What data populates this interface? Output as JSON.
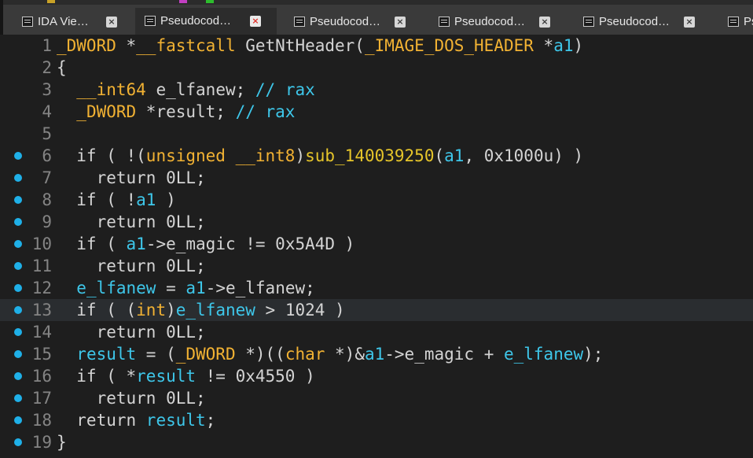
{
  "tabs": [
    {
      "label": "IDA Vie…",
      "active": false
    },
    {
      "label": "Pseudocod…",
      "active": true
    },
    {
      "label": "Pseudocod…",
      "active": false
    },
    {
      "label": "Pseudocod…",
      "active": false
    },
    {
      "label": "Pseudocod…",
      "active": false
    },
    {
      "label": "Ps",
      "active": false
    }
  ],
  "close_glyph": "×",
  "colors": {
    "breakpoint": "#1fb0e8",
    "keyword": "#f2b233",
    "variable": "#3ec7ea"
  },
  "code": {
    "lines": [
      {
        "num": "1",
        "bp": false,
        "tokens": [
          [
            "ty",
            "_DWORD"
          ],
          [
            "pl",
            " *"
          ],
          [
            "kw",
            "__fastcall"
          ],
          [
            "pl",
            " GetNtHeader("
          ],
          [
            "ty",
            "_IMAGE_DOS_HEADER"
          ],
          [
            "pl",
            " *"
          ],
          [
            "va",
            "a1"
          ],
          [
            "pl",
            ")"
          ]
        ]
      },
      {
        "num": "2",
        "bp": false,
        "tokens": [
          [
            "pl",
            "{"
          ]
        ]
      },
      {
        "num": "3",
        "bp": false,
        "tokens": [
          [
            "pl",
            "  "
          ],
          [
            "ty",
            "__int64"
          ],
          [
            "pl",
            " e_lfanew; "
          ],
          [
            "cm",
            "// rax"
          ]
        ]
      },
      {
        "num": "4",
        "bp": false,
        "tokens": [
          [
            "pl",
            "  "
          ],
          [
            "ty",
            "_DWORD"
          ],
          [
            "pl",
            " *result; "
          ],
          [
            "cm",
            "// rax"
          ]
        ]
      },
      {
        "num": "5",
        "bp": false,
        "tokens": []
      },
      {
        "num": "6",
        "bp": true,
        "tokens": [
          [
            "pl",
            "  if ( !("
          ],
          [
            "kw",
            "unsigned __int8"
          ],
          [
            "pl",
            ")"
          ],
          [
            "fn",
            "sub_140039250"
          ],
          [
            "pl",
            "("
          ],
          [
            "va",
            "a1"
          ],
          [
            "pl",
            ", 0x1000u) )"
          ]
        ]
      },
      {
        "num": "7",
        "bp": true,
        "tokens": [
          [
            "pl",
            "    return 0LL;"
          ]
        ]
      },
      {
        "num": "8",
        "bp": true,
        "tokens": [
          [
            "pl",
            "  if ( !"
          ],
          [
            "va",
            "a1"
          ],
          [
            "pl",
            " )"
          ]
        ]
      },
      {
        "num": "9",
        "bp": true,
        "tokens": [
          [
            "pl",
            "    return 0LL;"
          ]
        ]
      },
      {
        "num": "10",
        "bp": true,
        "tokens": [
          [
            "pl",
            "  if ( "
          ],
          [
            "va",
            "a1"
          ],
          [
            "pl",
            "->e_magic != 0x5A4D )"
          ]
        ]
      },
      {
        "num": "11",
        "bp": true,
        "tokens": [
          [
            "pl",
            "    return 0LL;"
          ]
        ]
      },
      {
        "num": "12",
        "bp": true,
        "tokens": [
          [
            "pl",
            "  "
          ],
          [
            "va",
            "e_lfanew"
          ],
          [
            "pl",
            " = "
          ],
          [
            "va",
            "a1"
          ],
          [
            "pl",
            "->e_lfanew;"
          ]
        ]
      },
      {
        "num": "13",
        "bp": true,
        "cur": true,
        "tokens": [
          [
            "pl",
            "  if ( ("
          ],
          [
            "kw",
            "int"
          ],
          [
            "pl",
            ")"
          ],
          [
            "va",
            "e_lfanew"
          ],
          [
            "pl",
            " > 1024 )"
          ]
        ]
      },
      {
        "num": "14",
        "bp": true,
        "tokens": [
          [
            "pl",
            "    return 0LL;"
          ]
        ]
      },
      {
        "num": "15",
        "bp": true,
        "tokens": [
          [
            "pl",
            "  "
          ],
          [
            "va",
            "result"
          ],
          [
            "pl",
            " = ("
          ],
          [
            "ty",
            "_DWORD"
          ],
          [
            "pl",
            " *)(("
          ],
          [
            "kw",
            "char"
          ],
          [
            "pl",
            " *)&"
          ],
          [
            "va",
            "a1"
          ],
          [
            "pl",
            "->e_magic + "
          ],
          [
            "va",
            "e_lfanew"
          ],
          [
            "pl",
            ");"
          ]
        ]
      },
      {
        "num": "16",
        "bp": true,
        "tokens": [
          [
            "pl",
            "  if ( *"
          ],
          [
            "va",
            "result"
          ],
          [
            "pl",
            " != 0x4550 )"
          ]
        ]
      },
      {
        "num": "17",
        "bp": true,
        "tokens": [
          [
            "pl",
            "    return 0LL;"
          ]
        ]
      },
      {
        "num": "18",
        "bp": true,
        "tokens": [
          [
            "pl",
            "  return "
          ],
          [
            "va",
            "result"
          ],
          [
            "pl",
            ";"
          ]
        ]
      },
      {
        "num": "19",
        "bp": true,
        "tokens": [
          [
            "pl",
            "}"
          ]
        ]
      }
    ]
  }
}
